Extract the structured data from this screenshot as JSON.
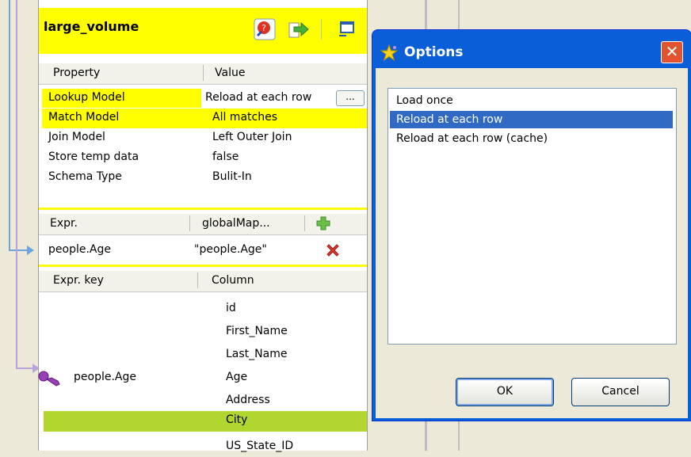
{
  "table": {
    "title": "large_volume",
    "header": {
      "property": "Property",
      "value": "Value"
    },
    "properties": [
      {
        "property": "Lookup Model",
        "value": "Reload at each row",
        "ellipsis": "..."
      },
      {
        "property": "Match Model",
        "value": "All matches"
      },
      {
        "property": "Join Model",
        "value": "Left Outer Join"
      },
      {
        "property": "Store temp data",
        "value": "false"
      },
      {
        "property": "Schema Type",
        "value": "Bulit-In"
      }
    ],
    "global_header": {
      "expr": "Expr.",
      "globalmap": "globalMap..."
    },
    "global_row": {
      "expr": "people.Age",
      "globalmap": "\"people.Age\""
    },
    "column_header": {
      "expr_key": "Expr. key",
      "column": "Column"
    },
    "columns": [
      {
        "expr_key": "",
        "column": "id"
      },
      {
        "expr_key": "",
        "column": "First_Name"
      },
      {
        "expr_key": "",
        "column": "Last_Name"
      },
      {
        "expr_key": "people.Age",
        "column": "Age"
      },
      {
        "expr_key": "",
        "column": "Address"
      },
      {
        "expr_key": "",
        "column": "City"
      },
      {
        "expr_key": "",
        "column": "US_State_ID"
      }
    ],
    "colors": {
      "highlight": "#ffff00",
      "selected_row": "#b0d62f"
    }
  },
  "dialog": {
    "title": "Options",
    "close": "✕",
    "options": [
      "Load once",
      "Reload at each row",
      "Reload at each row (cache)"
    ],
    "selected_option": "Reload at each row",
    "ok_label": "OK",
    "cancel_label": "Cancel",
    "colors": {
      "titlebar": "#0a5fd8",
      "selection": "#316ac5"
    }
  },
  "icons": {
    "title_bar": [
      "search-settings-icon",
      "green-arrow-icon",
      "window-icon"
    ],
    "add": "plus-icon",
    "remove": "red-x-icon",
    "key": "key-icon",
    "dialog": "star-icon"
  }
}
